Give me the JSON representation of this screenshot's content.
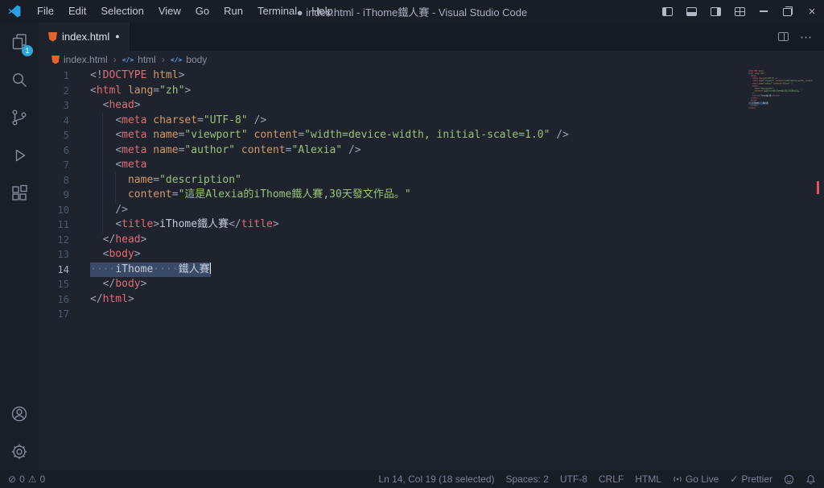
{
  "title_bar": {
    "menus": [
      "File",
      "Edit",
      "Selection",
      "View",
      "Go",
      "Run",
      "Terminal",
      "Help"
    ],
    "title": "● index.html - iThome鐵人賽 - Visual Studio Code"
  },
  "activity_bar": {
    "items": [
      "explorer",
      "search",
      "source-control",
      "run-and-debug",
      "extensions"
    ],
    "bottom_items": [
      "accounts",
      "settings"
    ],
    "explorer_badge": "1"
  },
  "tab_bar": {
    "active_tab": "index.html",
    "modified": true
  },
  "breadcrumb": {
    "items": [
      "index.html",
      "html",
      "body"
    ]
  },
  "icons": {
    "close": "×",
    "more": "⋯",
    "dot": "●",
    "chevron": "›",
    "symbol": "</>",
    "error": "⊘",
    "warning": "⚠",
    "check": "✓"
  },
  "colors": {
    "tag": "#e06c75",
    "attribute": "#d19a66",
    "string": "#98c379",
    "selection": "#394a68",
    "badge": "#2fa4d9",
    "file_icon_orange": "#e5642d"
  },
  "editor": {
    "lines": [
      {
        "n": "1",
        "tokens": [
          [
            "p",
            "<!"
          ],
          [
            "t",
            "DOCTYPE"
          ],
          [
            "x",
            " "
          ],
          [
            "a",
            "html"
          ],
          [
            "p",
            ">"
          ]
        ]
      },
      {
        "n": "2",
        "tokens": [
          [
            "p",
            "<"
          ],
          [
            "t",
            "html"
          ],
          [
            "x",
            " "
          ],
          [
            "a",
            "lang"
          ],
          [
            "p",
            "="
          ],
          [
            "s",
            "\"zh\""
          ],
          [
            "p",
            ">"
          ]
        ]
      },
      {
        "n": "3",
        "tokens": [
          [
            "x",
            "  "
          ],
          [
            "p",
            "<"
          ],
          [
            "t",
            "head"
          ],
          [
            "p",
            ">"
          ]
        ]
      },
      {
        "n": "4",
        "tokens": [
          [
            "x",
            "    "
          ],
          [
            "p",
            "<"
          ],
          [
            "t",
            "meta"
          ],
          [
            "x",
            " "
          ],
          [
            "a",
            "charset"
          ],
          [
            "p",
            "="
          ],
          [
            "s",
            "\"UTF-8\""
          ],
          [
            "x",
            " "
          ],
          [
            "p",
            "/>"
          ]
        ]
      },
      {
        "n": "5",
        "tokens": [
          [
            "x",
            "    "
          ],
          [
            "p",
            "<"
          ],
          [
            "t",
            "meta"
          ],
          [
            "x",
            " "
          ],
          [
            "a",
            "name"
          ],
          [
            "p",
            "="
          ],
          [
            "s",
            "\"viewport\""
          ],
          [
            "x",
            " "
          ],
          [
            "a",
            "content"
          ],
          [
            "p",
            "="
          ],
          [
            "s",
            "\"width=device-width, initial-scale=1.0\""
          ],
          [
            "x",
            " "
          ],
          [
            "p",
            "/>"
          ]
        ]
      },
      {
        "n": "6",
        "tokens": [
          [
            "x",
            "    "
          ],
          [
            "p",
            "<"
          ],
          [
            "t",
            "meta"
          ],
          [
            "x",
            " "
          ],
          [
            "a",
            "name"
          ],
          [
            "p",
            "="
          ],
          [
            "s",
            "\"author\""
          ],
          [
            "x",
            " "
          ],
          [
            "a",
            "content"
          ],
          [
            "p",
            "="
          ],
          [
            "s",
            "\"Alexia\""
          ],
          [
            "x",
            " "
          ],
          [
            "p",
            "/>"
          ]
        ]
      },
      {
        "n": "7",
        "tokens": [
          [
            "x",
            "    "
          ],
          [
            "p",
            "<"
          ],
          [
            "t",
            "meta"
          ]
        ]
      },
      {
        "n": "8",
        "tokens": [
          [
            "x",
            "      "
          ],
          [
            "a",
            "name"
          ],
          [
            "p",
            "="
          ],
          [
            "s",
            "\"description\""
          ]
        ]
      },
      {
        "n": "9",
        "tokens": [
          [
            "x",
            "      "
          ],
          [
            "a",
            "content"
          ],
          [
            "p",
            "="
          ],
          [
            "s",
            "\"這是Alexia的iThome鐵人賽,30天發文作品。\""
          ]
        ]
      },
      {
        "n": "10",
        "tokens": [
          [
            "x",
            "    "
          ],
          [
            "p",
            "/>"
          ]
        ]
      },
      {
        "n": "11",
        "tokens": [
          [
            "x",
            "    "
          ],
          [
            "p",
            "<"
          ],
          [
            "t",
            "title"
          ],
          [
            "p",
            ">"
          ],
          [
            "x",
            "iThome鐵人賽"
          ],
          [
            "p",
            "</"
          ],
          [
            "t",
            "title"
          ],
          [
            "p",
            ">"
          ]
        ]
      },
      {
        "n": "12",
        "tokens": [
          [
            "x",
            "  "
          ],
          [
            "p",
            "</"
          ],
          [
            "t",
            "head"
          ],
          [
            "p",
            ">"
          ]
        ]
      },
      {
        "n": "13",
        "tokens": [
          [
            "x",
            "  "
          ],
          [
            "p",
            "<"
          ],
          [
            "t",
            "body"
          ],
          [
            "p",
            ">"
          ]
        ]
      },
      {
        "n": "14",
        "sel": true,
        "cursor": true,
        "tokens": [
          [
            "w",
            "····"
          ],
          [
            "x",
            "iThome"
          ],
          [
            "w",
            "····"
          ],
          [
            "x",
            "鐵人賽"
          ]
        ]
      },
      {
        "n": "15",
        "tokens": [
          [
            "x",
            "  "
          ],
          [
            "p",
            "</"
          ],
          [
            "t",
            "body"
          ],
          [
            "p",
            ">"
          ]
        ]
      },
      {
        "n": "16",
        "tokens": [
          [
            "p",
            "</"
          ],
          [
            "t",
            "html"
          ],
          [
            "p",
            ">"
          ]
        ]
      },
      {
        "n": "17",
        "tokens": []
      }
    ]
  },
  "status_bar": {
    "errors": "0",
    "warnings": "0",
    "cursor_position": "Ln 14, Col 19 (18 selected)",
    "indentation": "Spaces: 2",
    "encoding": "UTF-8",
    "eol": "CRLF",
    "language": "HTML",
    "go_live": "Go Live",
    "formatter": "Prettier"
  }
}
